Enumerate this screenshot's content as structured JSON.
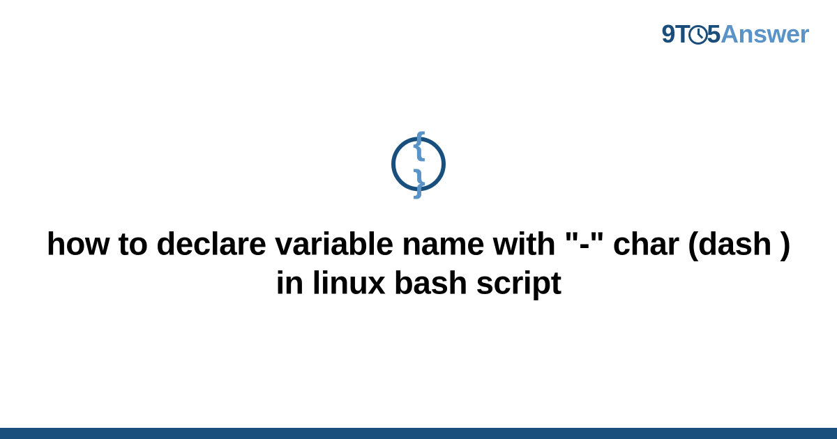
{
  "logo": {
    "prefix": "9T",
    "middle": "5",
    "suffix": "Answer"
  },
  "icon": {
    "glyph": "{ }",
    "name": "braces-icon"
  },
  "title": "how to declare variable name with \"-\" char (dash ) in linux bash script",
  "colors": {
    "brand_dark": "#184f7d",
    "brand_light": "#5a93c7"
  }
}
